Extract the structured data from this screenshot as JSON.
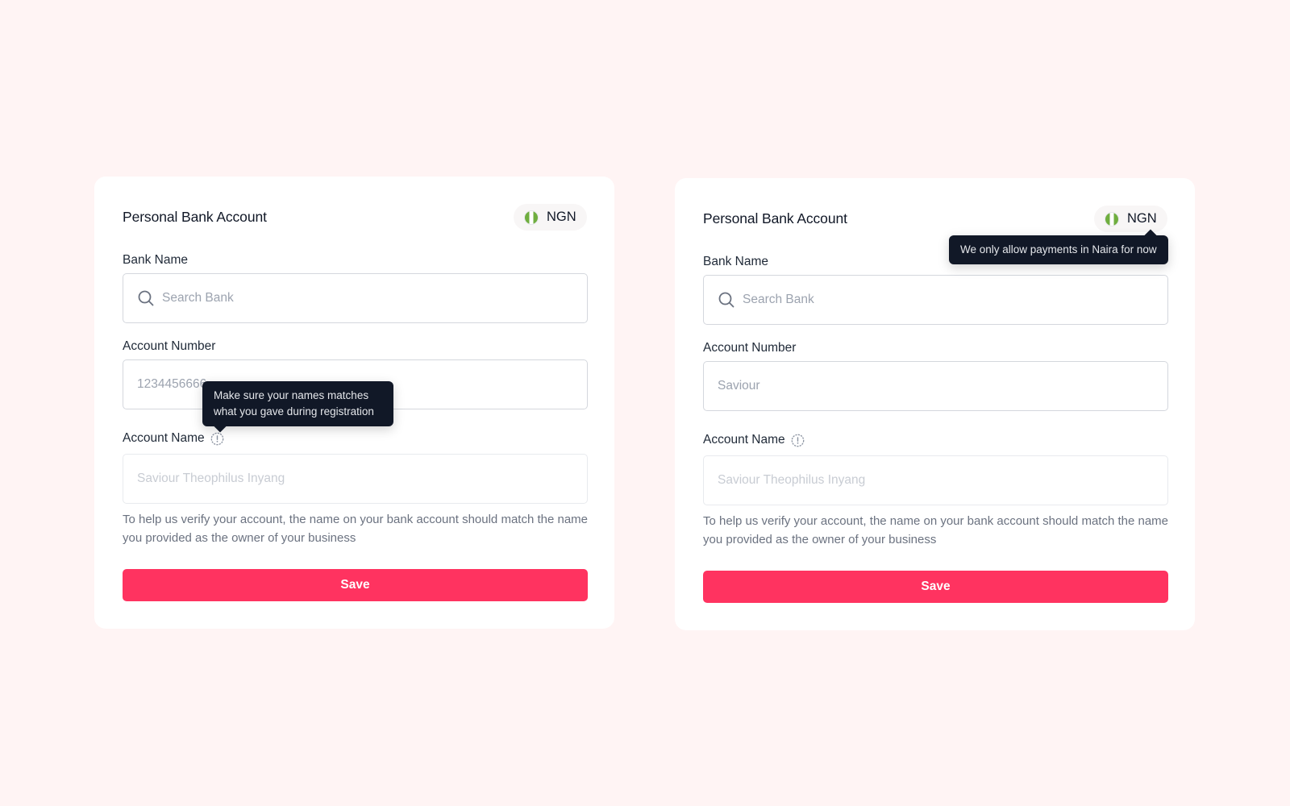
{
  "colors": {
    "background": "#fff4f4",
    "accent": "#ff3360",
    "tooltip": "#111827",
    "flag_green": "#6fae3f"
  },
  "cards": [
    {
      "title": "Personal Bank Account",
      "currency": {
        "code": "NGN",
        "flag_icon": "nigeria-flag-icon"
      },
      "bank_name": {
        "label": "Bank Name",
        "placeholder": "Search Bank"
      },
      "account_number": {
        "label": "Account Number",
        "value": "1234456666"
      },
      "account_name": {
        "label": "Account Name",
        "placeholder": "Saviour Theophilus Inyang"
      },
      "help_text": "To help us verify your account, the name on your bank account should match the name you provided as the owner of your business",
      "save_label": "Save",
      "tooltip": "Make sure your names matches what you gave during registration"
    },
    {
      "title": "Personal Bank Account",
      "currency": {
        "code": "NGN",
        "flag_icon": "nigeria-flag-icon"
      },
      "bank_name": {
        "label": "Bank Name",
        "placeholder": "Search Bank"
      },
      "account_number": {
        "label": "Account Number",
        "value": "Saviour"
      },
      "account_name": {
        "label": "Account Name",
        "placeholder": "Saviour Theophilus Inyang"
      },
      "help_text": "To help us verify your account, the name on your bank account should match the name you provided as the owner of your business",
      "save_label": "Save",
      "tooltip": "We only allow payments in Naira for now"
    }
  ]
}
